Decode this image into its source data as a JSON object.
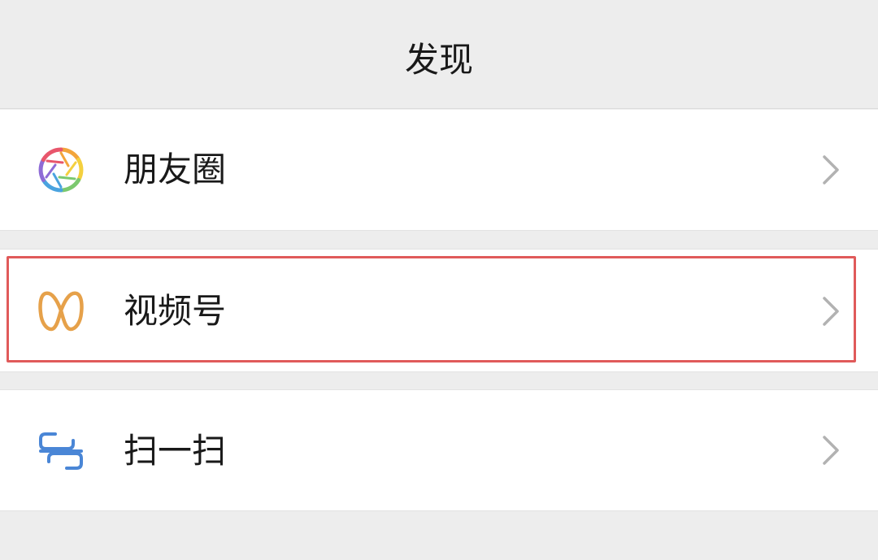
{
  "header": {
    "title": "发现"
  },
  "menu": {
    "items": [
      {
        "label": "朋友圈",
        "icon": "moments-aperture-icon"
      },
      {
        "label": "视频号",
        "icon": "channels-butterfly-icon"
      },
      {
        "label": "扫一扫",
        "icon": "scan-icon"
      }
    ]
  },
  "colors": {
    "background": "#ededed",
    "row_background": "#ffffff",
    "text": "#191919",
    "chevron": "#b2b2b2",
    "channels_icon": "#e6a14a",
    "scan_icon": "#4a86d6",
    "highlight": "#e05a5a"
  }
}
